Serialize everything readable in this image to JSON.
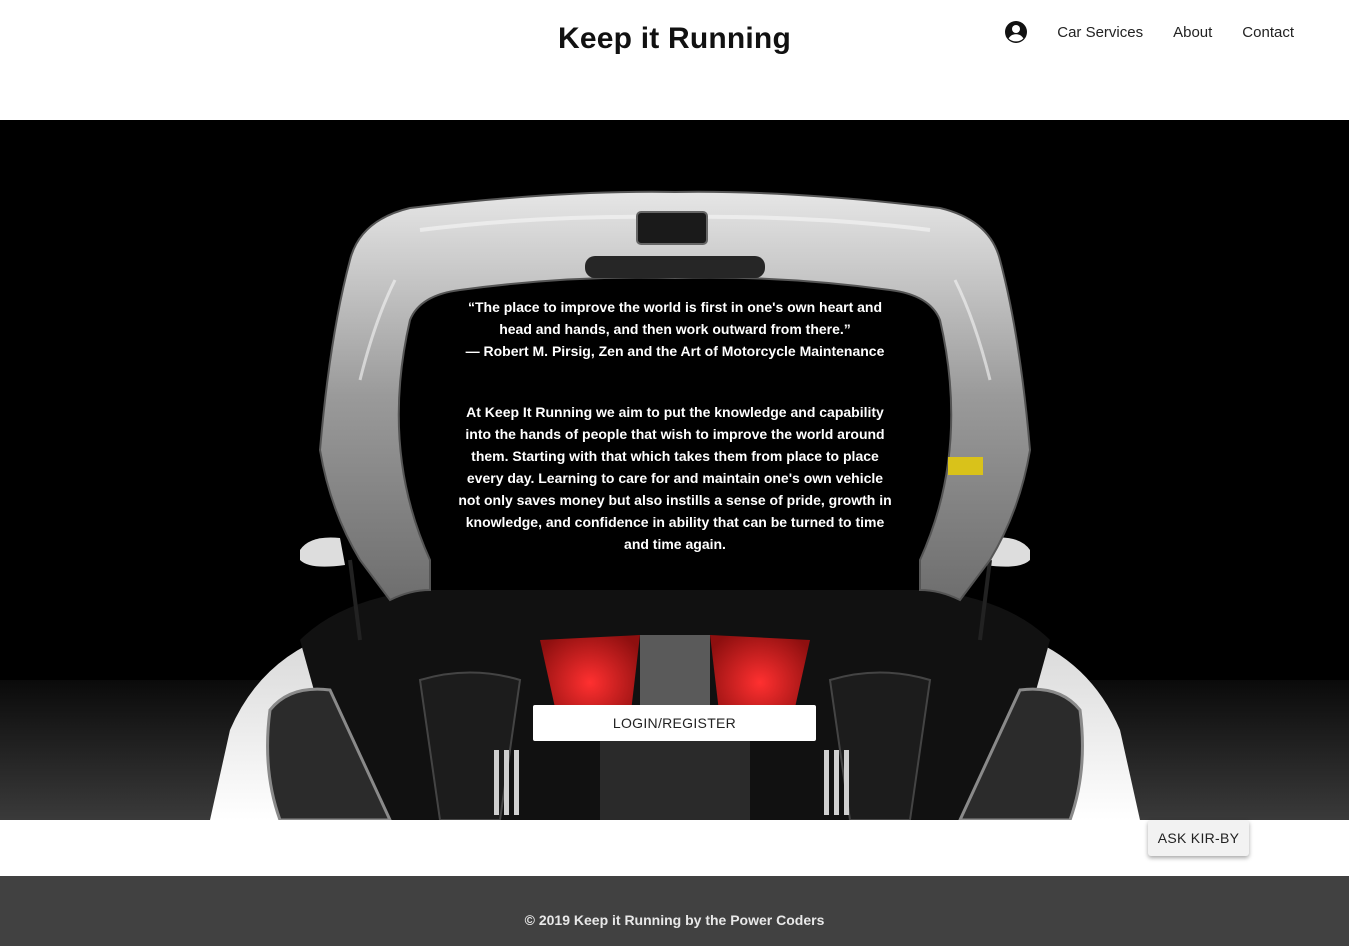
{
  "header": {
    "title": "Keep it Running",
    "nav": {
      "account_icon": "account-circle-icon",
      "items": [
        {
          "label": "Car Services"
        },
        {
          "label": "About"
        },
        {
          "label": "Contact"
        }
      ]
    }
  },
  "hero": {
    "quote_lines": [
      "“The place to improve the world is first in one's own heart and",
      "head and hands, and then work outward from there.”",
      "— Robert M. Pirsig, Zen and the Art of Motorcycle Maintenance"
    ],
    "mission": "At Keep It Running we aim to put the knowledge and capability into the hands of people that wish to improve the world around them. Starting with that which takes them from place to place every day. Learning to care for and maintain one's own vehicle not only saves money but also instills a sense of pride, growth in knowledge, and confidence in ability that can be turned to time and time again.",
    "login_label": "LOGIN/REGISTER"
  },
  "chat": {
    "ask_label": "ASK KIR-BY"
  },
  "footer": {
    "text": "© 2019 Keep it Running by the Power Coders"
  },
  "colors": {
    "hero_background": "#000000",
    "footer_background": "#414141",
    "engine_accent": "#d41c1c"
  }
}
